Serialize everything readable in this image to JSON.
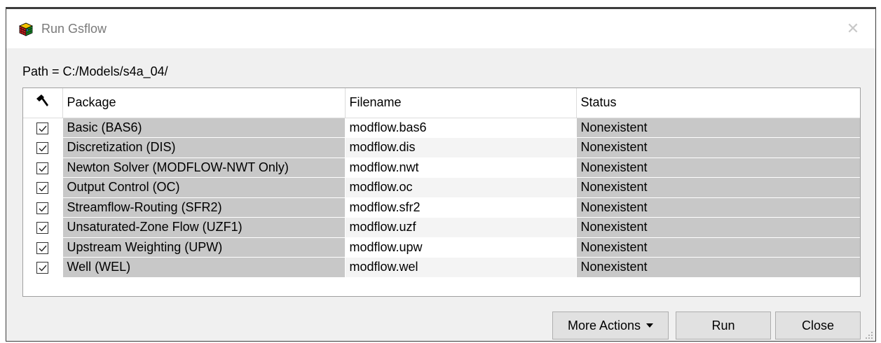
{
  "window": {
    "title": "Run Gsflow",
    "close_glyph": "✕",
    "app_icon": "rubiks-cube-icon"
  },
  "path_label": "Path = C:/Models/s4a_04/",
  "table": {
    "columns": [
      "",
      "Package",
      "Filename",
      "Status"
    ],
    "header_icon": "hammer-icon",
    "rows": [
      {
        "checked": true,
        "package": "Basic (BAS6)",
        "filename": "modflow.bas6",
        "status": "Nonexistent"
      },
      {
        "checked": true,
        "package": "Discretization (DIS)",
        "filename": "modflow.dis",
        "status": "Nonexistent"
      },
      {
        "checked": true,
        "package": "Newton Solver (MODFLOW-NWT Only)",
        "filename": "modflow.nwt",
        "status": "Nonexistent"
      },
      {
        "checked": true,
        "package": "Output Control (OC)",
        "filename": "modflow.oc",
        "status": "Nonexistent"
      },
      {
        "checked": true,
        "package": "Streamflow-Routing (SFR2)",
        "filename": "modflow.sfr2",
        "status": "Nonexistent"
      },
      {
        "checked": true,
        "package": "Unsaturated-Zone Flow (UZF1)",
        "filename": "modflow.uzf",
        "status": "Nonexistent"
      },
      {
        "checked": true,
        "package": "Upstream Weighting (UPW)",
        "filename": "modflow.upw",
        "status": "Nonexistent"
      },
      {
        "checked": true,
        "package": "Well (WEL)",
        "filename": "modflow.wel",
        "status": "Nonexistent"
      }
    ]
  },
  "buttons": {
    "more_actions": "More Actions",
    "run": "Run",
    "close": "Close"
  },
  "colors": {
    "cell_gray": "#c8c8c8",
    "dialog_bg": "#f0f0f0",
    "button_bg": "#e1e1e1"
  }
}
